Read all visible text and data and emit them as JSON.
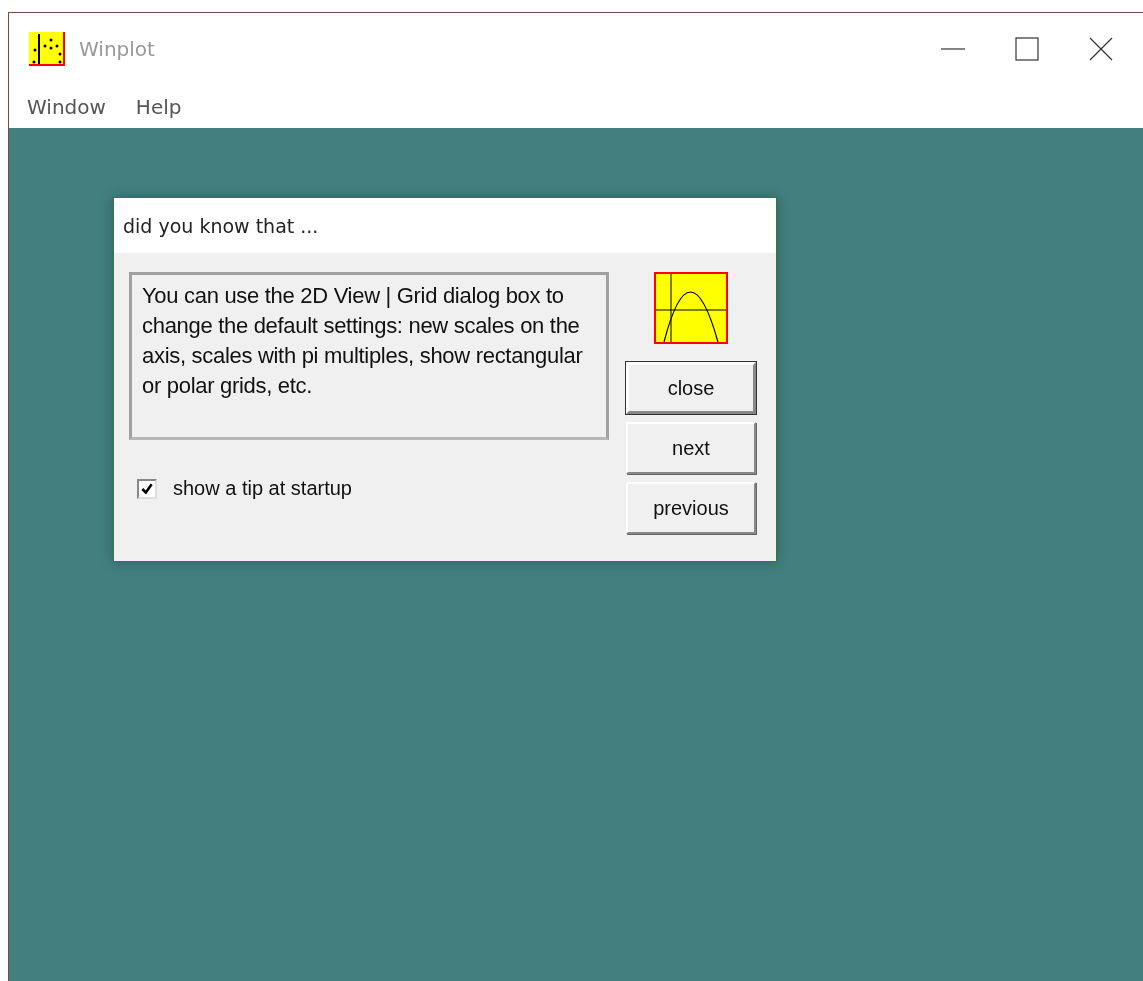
{
  "window": {
    "title": "Winplot"
  },
  "menu": [
    "Window",
    "Help"
  ],
  "dialog": {
    "title": "did you know that ...",
    "tip": "You can use the 2D View | Grid dialog box to change the default settings: new scales on the axis, scales with pi multiples, show rectangular or polar grids, etc.",
    "startup_checkbox": {
      "label": "show a tip at startup",
      "checked": true
    },
    "buttons": [
      {
        "label": "close",
        "default": true
      },
      {
        "label": "next",
        "default": false
      },
      {
        "label": "previous",
        "default": false
      }
    ]
  }
}
